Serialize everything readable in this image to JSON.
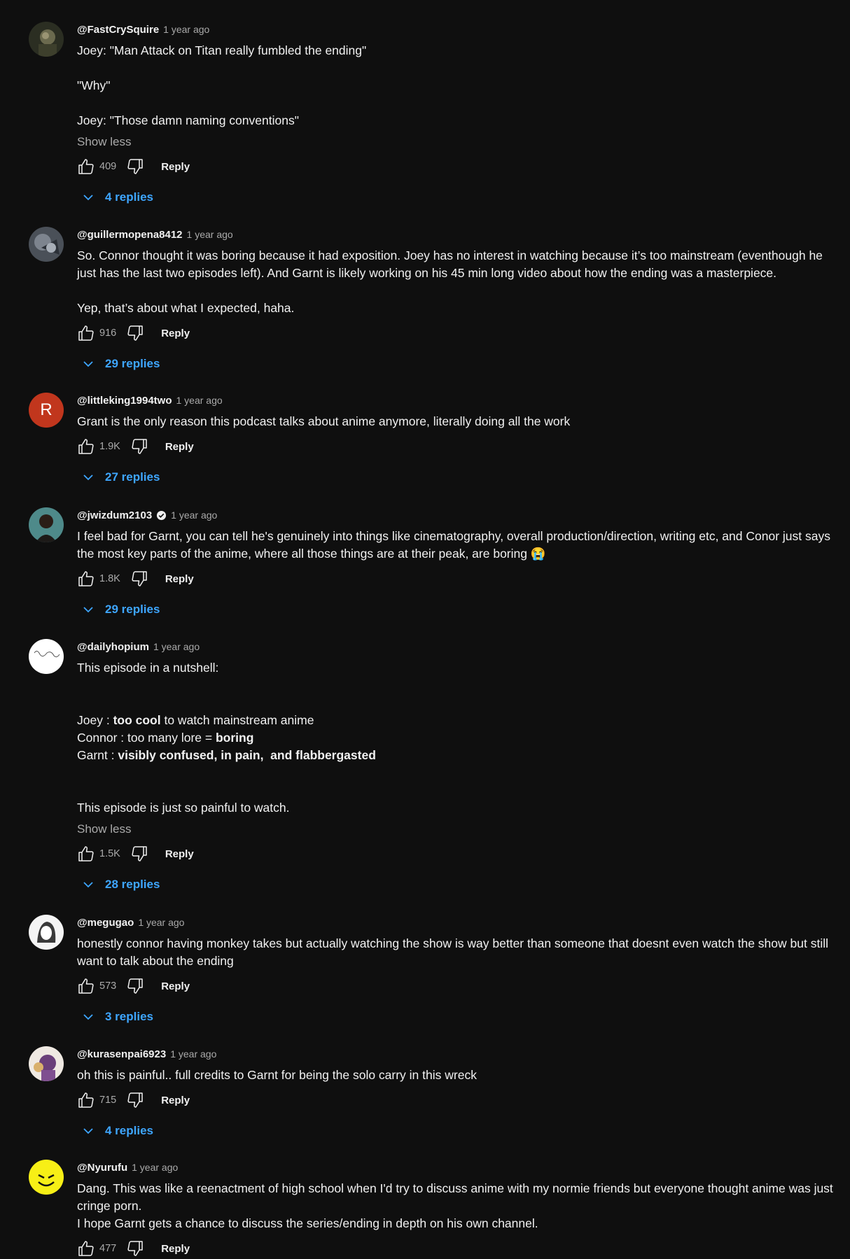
{
  "labels": {
    "reply": "Reply",
    "show_less": "Show less"
  },
  "comments": [
    {
      "author": "@FastCrySquire",
      "time": "1 year ago",
      "lines": [
        "Joey: \"Man Attack on Titan really fumbled the ending\"",
        "",
        "\"Why\"",
        "",
        "Joey: \"Those damn naming conventions\""
      ],
      "show_less": true,
      "likes": "409",
      "replies": "4 replies"
    },
    {
      "author": "@guillermopena8412",
      "time": "1 year ago",
      "lines": [
        "So. Connor thought it was boring because it had exposition. Joey has no interest in watching because it’s too mainstream (eventhough he just has the last two episodes left). And Garnt is likely working on his 45 min long video about how the ending was a masterpiece.",
        "",
        "Yep, that’s about what I expected, haha."
      ],
      "likes": "916",
      "replies": "29 replies"
    },
    {
      "author": "@littleking1994two",
      "time": "1 year ago",
      "avatar_letter": "R",
      "lines": [
        "Grant is the only reason this podcast talks about anime anymore, literally doing all the work"
      ],
      "likes": "1.9K",
      "replies": "27 replies"
    },
    {
      "author": "@jwizdum2103",
      "time": "1 year ago",
      "verified": true,
      "lines": [
        "I feel bad for Garnt, you can tell he's genuinely into things like cinematography, overall production/direction, writing etc, and Conor just says the most key parts of the anime, where all those things are at their peak, are boring 😭"
      ],
      "likes": "1.8K",
      "replies": "29 replies"
    },
    {
      "author": "@dailyhopium",
      "time": "1 year ago",
      "line1": "This episode in a nutshell:",
      "joey_prefix": "Joey : ",
      "joey_bold": "too cool",
      "joey_suffix": " to watch mainstream anime",
      "connor_prefix": "Connor : too many lore = ",
      "connor_bold": "boring",
      "garnt_prefix": "Garnt : ",
      "garnt_bold": "visibly confused, in pain,  and flabbergasted",
      "last_line": "This episode is just so painful to watch.",
      "show_less": true,
      "likes": "1.5K",
      "replies": "28 replies"
    },
    {
      "author": "@megugao",
      "time": "1 year ago",
      "lines": [
        "honestly connor having monkey takes but actually watching the show is way better than someone that doesnt even watch the show but still want to talk about the ending"
      ],
      "likes": "573",
      "replies": "3 replies"
    },
    {
      "author": "@kurasenpai6923",
      "time": "1 year ago",
      "lines": [
        "oh this is painful.. full credits to Garnt for being the solo carry in this wreck"
      ],
      "likes": "715",
      "replies": "4 replies"
    },
    {
      "author": "@Nyurufu",
      "time": "1 year ago",
      "lines": [
        "Dang. This was like a reenactment of high school when I'd try to discuss anime with my normie friends but everyone thought anime was just cringe porn.",
        "I hope Garnt gets a chance to discuss the series/ending in depth on his own channel."
      ],
      "likes": "477"
    }
  ]
}
